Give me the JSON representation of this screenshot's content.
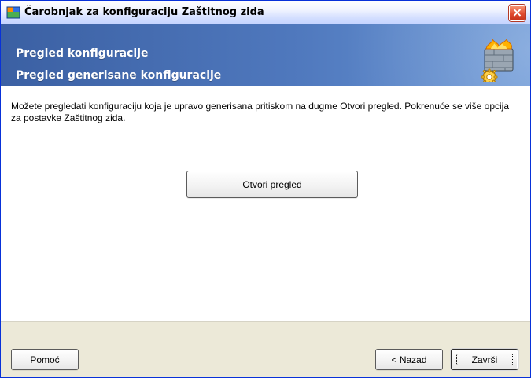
{
  "window": {
    "title": "Čarobnjak za konfiguraciju Zaštitnog zida",
    "close_label": "×"
  },
  "header": {
    "title": "Pregled konfiguracije",
    "subtitle": "Pregled generisane konfiguracije"
  },
  "content": {
    "description": "Možete pregledati konfiguraciju koja je upravo generisana pritiskom na dugme Otvori pregled. Pokrenuće se više opcija za postavke Zaštitnog zida.",
    "open_preview_label": "Otvori pregled"
  },
  "footer": {
    "help_label": "Pomoć",
    "back_label": "< Nazad",
    "finish_label": "Završi"
  },
  "colors": {
    "header_start": "#3b60a3",
    "header_end": "#6a97d6",
    "close_red": "#e04a2f"
  },
  "icons": {
    "app": "firewall-wizard-icon",
    "header": "firewall-gear-icon",
    "close": "close-icon"
  }
}
